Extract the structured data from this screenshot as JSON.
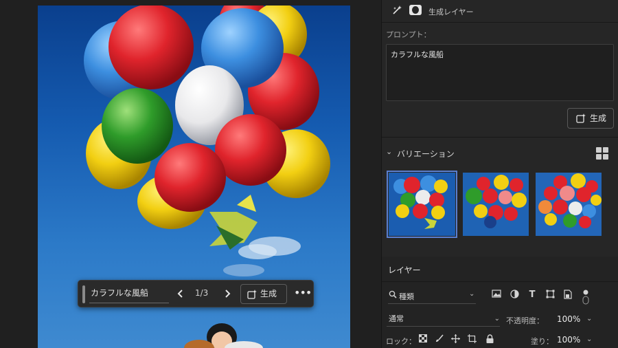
{
  "canvas": {
    "context_bar": {
      "prompt": "カラフルな風船",
      "counter": "1/3",
      "generate_label": "生成",
      "more_label": "•••"
    }
  },
  "panel": {
    "header_title": "生成レイヤー",
    "prompt_label": "プロンプト：",
    "prompt_value": "カラフルな風船",
    "generate_label": "生成",
    "variations": {
      "title": "バリエーション",
      "count": 3,
      "selected_index": 0
    },
    "layers": {
      "title": "レイヤー",
      "filter_value": "種類",
      "blend_mode": "通常",
      "opacity_label": "不透明度：",
      "opacity_value": "100%",
      "lock_label": "ロック：",
      "fill_label": "塗り：",
      "fill_value": "100%"
    }
  },
  "colors": {
    "panel_bg": "#262626",
    "sky_blue": "#155bb0",
    "selection_outline": "#5a7fd0"
  }
}
